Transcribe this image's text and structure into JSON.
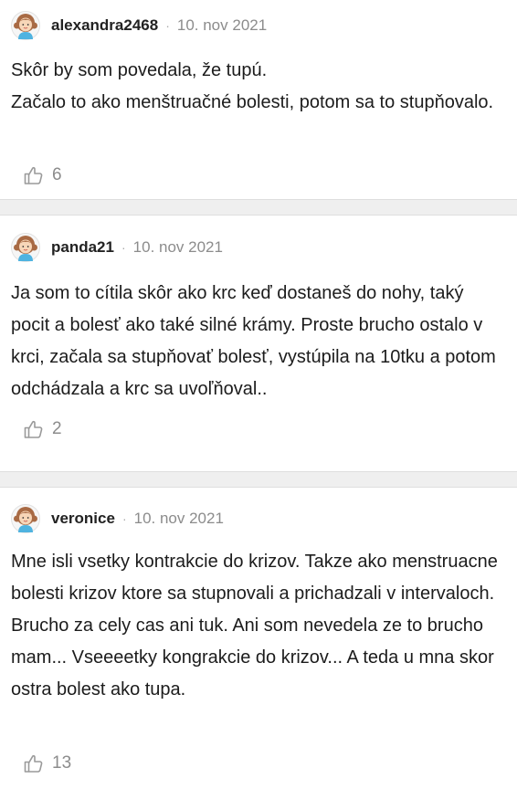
{
  "comments": [
    {
      "username": "alexandra2468",
      "date": "10. nov 2021",
      "text": "Skôr by som povedala, že tupú.\nZačalo to ako menštruačné bolesti, potom sa to stupňovalo.",
      "likes": "6"
    },
    {
      "username": "panda21",
      "date": "10. nov 2021",
      "text": "Ja som to cítila skôr ako krc keď dostaneš do nohy, taký pocit a bolesť ako také silné krámy. Proste brucho ostalo v krci, začala sa stupňovať bolesť, vystúpila na 10tku a potom odchádzala a krc sa uvoľňoval..",
      "likes": "2"
    },
    {
      "username": "veronice",
      "date": "10. nov 2021",
      "text": "Mne isli vsetky kontrakcie do krizov. Takze ako menstruacne bolesti krizov ktore sa stupnovali a prichadzali v intervaloch. Brucho za cely cas ani tuk. Ani som nevedela ze to brucho mam... Vseeeetky kongrakcie do krizov... A teda u mna skor ostra bolest ako tupa.",
      "likes": "13"
    }
  ],
  "separator": "·",
  "icons": {
    "avatar": "girl-avatar-icon",
    "like": "thumbs-up-icon"
  },
  "colors": {
    "text": "#1c1c1c",
    "meta": "#8c8c8c",
    "separator_bg": "#efefef"
  }
}
